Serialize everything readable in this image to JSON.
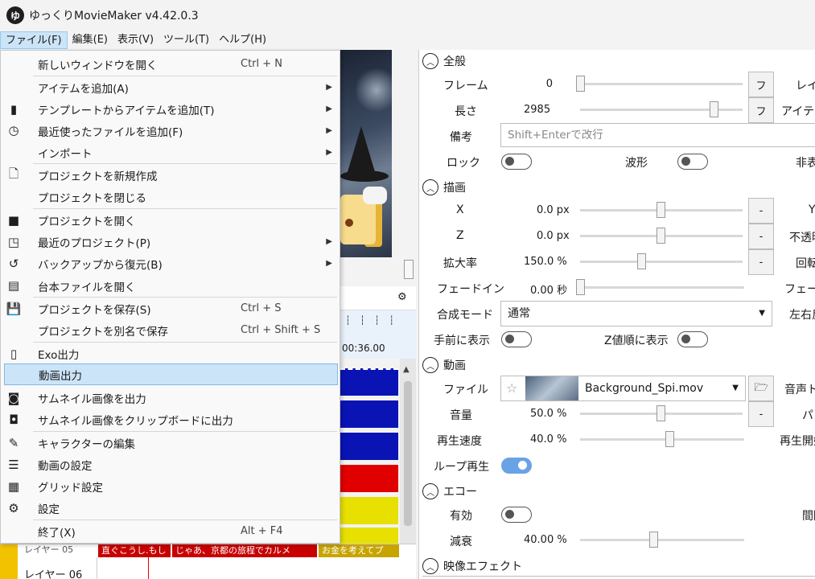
{
  "app": {
    "title": "ゆっくりMovieMaker v4.42.0.3",
    "icon_char": "ゆ"
  },
  "menubar": [
    "ファイル(F)",
    "編集(E)",
    "表示(V)",
    "ツール(T)",
    "ヘルプ(H)"
  ],
  "file_menu": {
    "items": [
      {
        "label": "新しいウィンドウを開く",
        "shortcut": "Ctrl + N"
      },
      {
        "label": "アイテムを追加(A)",
        "submenu": true
      },
      {
        "label": "テンプレートからアイテムを追加(T)",
        "submenu": true
      },
      {
        "label": "最近使ったファイルを追加(F)",
        "submenu": true
      },
      {
        "label": "インポート",
        "submenu": true
      },
      {
        "label": "プロジェクトを新規作成"
      },
      {
        "label": "プロジェクトを閉じる"
      },
      {
        "label": "プロジェクトを開く"
      },
      {
        "label": "最近のプロジェクト(P)",
        "submenu": true
      },
      {
        "label": "バックアップから復元(B)",
        "submenu": true
      },
      {
        "label": "台本ファイルを開く"
      },
      {
        "label": "プロジェクトを保存(S)",
        "shortcut": "Ctrl + S"
      },
      {
        "label": "プロジェクトを別名で保存",
        "shortcut": "Ctrl + Shift + S"
      },
      {
        "label": "Exo出力"
      },
      {
        "label": "動画出力",
        "highlighted": true
      },
      {
        "label": "サムネイル画像を出力"
      },
      {
        "label": "サムネイル画像をクリップボードに出力"
      },
      {
        "label": "キャラクターの編集"
      },
      {
        "label": "動画の設定"
      },
      {
        "label": "グリッド設定"
      },
      {
        "label": "設定"
      },
      {
        "label": "終了(X)",
        "shortcut": "Alt + F4"
      }
    ]
  },
  "timeline": {
    "time_label": "00:36.00",
    "layer_05_label": "レイヤー 05",
    "layer_06_label": "レイヤー 06",
    "clips": [
      "直ぐこうし.もし",
      "じゃあ、京都の旅程でカルメ",
      "お金を考えてプ"
    ],
    "track_colors": [
      "#0a14b4",
      "#0a14b4",
      "#0a14b4",
      "#e00000",
      "#e8e000",
      "#e8e000"
    ]
  },
  "props": {
    "general": {
      "title": "全般",
      "frame_label": "フレーム",
      "frame_value": "0",
      "length_label": "長さ",
      "length_value": "2985",
      "note_label": "備考",
      "note_placeholder": "Shift+Enterで改行",
      "lock_label": "ロック",
      "wave_label": "波形",
      "layer_cut": "レイ",
      "item_cut": "アイテ",
      "hidden_cut": "非表",
      "f_button": "フ"
    },
    "draw": {
      "title": "描画",
      "x_label": "X",
      "x_value": "0.0 px",
      "z_label": "Z",
      "z_value": "0.0 px",
      "zoom_label": "拡大率",
      "zoom_value": "150.0 %",
      "fadein_label": "フェードイン",
      "fadein_value": "0.00 秒",
      "blend_label": "合成モード",
      "blend_value": "通常",
      "front_label": "手前に表示",
      "zorder_label": "Z値順に表示",
      "minus_button": "-",
      "y_cut": "Y",
      "opacity_cut": "不透明",
      "rotate_cut": "回転",
      "fadeout_cut": "フェード",
      "flip_cut": "左右反"
    },
    "video": {
      "title": "動画",
      "file_label": "ファイル",
      "file_value": "Background_Spi.mov",
      "volume_label": "音量",
      "volume_value": "50.0 %",
      "speed_label": "再生速度",
      "speed_value": "40.0 %",
      "loop_label": "ループ再生",
      "audio_cut": "音声ト",
      "pan_cut": "パン",
      "start_cut": "再生開始"
    },
    "echo": {
      "title": "エコー",
      "enabled_label": "有効",
      "decay_label": "減衰",
      "decay_value": "40.00 %",
      "interval_cut": "間隔"
    },
    "effects": {
      "title": "映像エフェクト"
    }
  }
}
